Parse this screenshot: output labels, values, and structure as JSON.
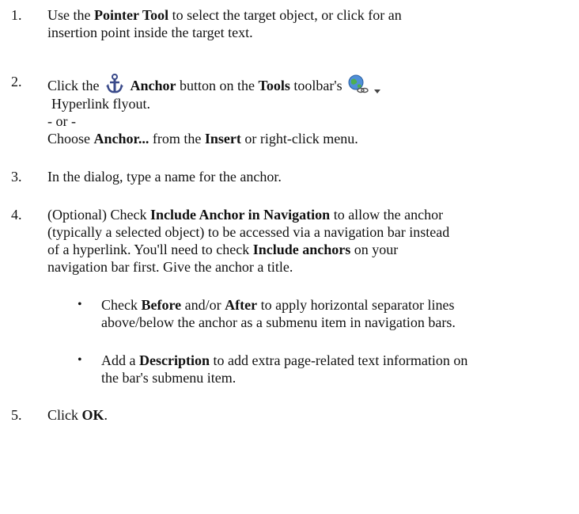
{
  "steps": [
    {
      "num": "1.",
      "l1": {
        "a": "Use the ",
        "b1": "Pointer Tool",
        "c": " to select the target object, or click for an"
      },
      "l2": "insertion point inside the target text."
    },
    {
      "num": "2.",
      "l1": {
        "a": "Click the",
        "b1": "Anchor",
        "c": " button on the ",
        "b2": "Tools",
        "d": " toolbar's"
      },
      "l2": "Hyperlink flyout.",
      "l3": "- or -",
      "l4": {
        "a": "Choose ",
        "b1": "Anchor...",
        "c": " from the ",
        "b2": "Insert",
        "d": " or right-click menu."
      }
    },
    {
      "num": "3.",
      "l1": "In the dialog, type a name for the anchor."
    },
    {
      "num": "4.",
      "l1": {
        "a": "(Optional) Check ",
        "b1": "Include Anchor in Navigation",
        "c": " to allow the anchor"
      },
      "l2": "(typically a selected object) to be accessed via a navigation bar instead",
      "l3": {
        "a": "of a hyperlink. You'll need to check ",
        "b1": "Include anchors",
        "c": " on your"
      },
      "l4": "navigation bar first. Give the anchor a title.",
      "bullets": [
        {
          "dot": "•",
          "l1": {
            "a": "Check ",
            "b1": "Before",
            "c": " and/or ",
            "b2": "After",
            "d": " to apply horizontal separator lines"
          },
          "l2": "above/below the anchor as a submenu item in navigation bars."
        },
        {
          "dot": "•",
          "l1": {
            "a": "Add a ",
            "b1": "Description",
            "c": " to add extra page-related text information on"
          },
          "l2": "the bar's submenu item."
        }
      ]
    },
    {
      "num": "5.",
      "l1": {
        "a": "Click ",
        "b1": "OK",
        "c": "."
      }
    }
  ],
  "icons": {
    "anchor": "anchor-icon",
    "hyperlink": "hyperlink-globe-icon",
    "dropdown": "dropdown-arrow-icon"
  }
}
